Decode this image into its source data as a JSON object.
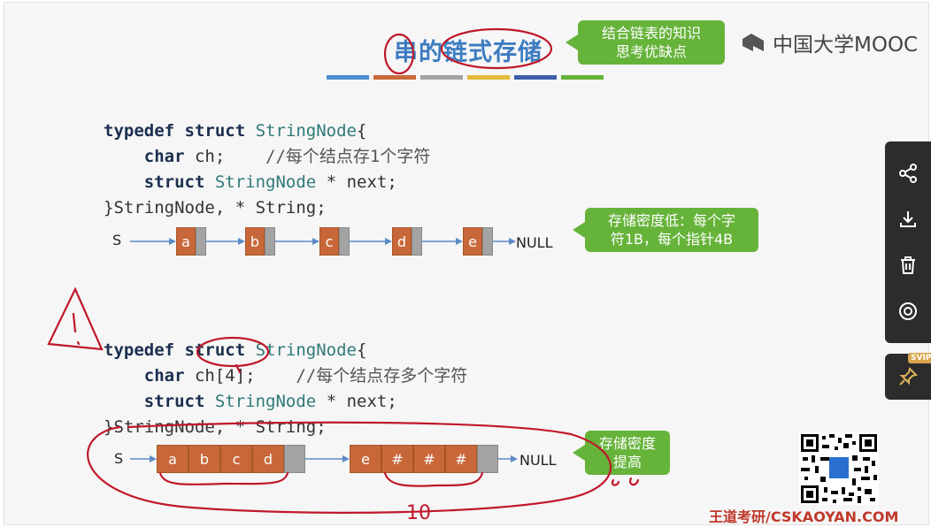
{
  "title": "串的链式存储",
  "brand": {
    "name": "中国大学MOOC"
  },
  "colors": {
    "title": "#3d7cc1",
    "callout": "#66b33a",
    "node": "#c8683a",
    "pointer": "#a3a3a3",
    "ink": "#c0182a"
  },
  "title_bar_colors": [
    "#4a8ecf",
    "#c8683a",
    "#a3a3a3",
    "#e6b93a",
    "#3d5fa8",
    "#66b33a"
  ],
  "callouts": {
    "top": "结合链表的知识\n思考优缺点",
    "middle": "存储密度低：每个字\n符1B，每个指针4B",
    "bottom": "存储密度\n提高"
  },
  "code1": {
    "l1_kw": "typedef struct",
    "l1_ty": " StringNode",
    "l1_rest": "{",
    "l2_kw": "char",
    "l2_rest": " ch;",
    "l2_cm": "    //每个结点存1个字符",
    "l3_kw": "struct",
    "l3_ty": " StringNode",
    "l3_rest": " * next;",
    "l4": "}StringNode, * String;"
  },
  "code2": {
    "l1_kw": "typedef struct",
    "l1_ty": " StringNode",
    "l1_rest": "{",
    "l2_kw": "char",
    "l2_rest": " ch[4];",
    "l2_cm": "    //每个结点存多个字符",
    "l3_kw": "struct",
    "l3_ty": " StringNode",
    "l3_rest": " * next;",
    "l4": "}StringNode, * String;"
  },
  "list1": {
    "head": "S",
    "nodes": [
      "a",
      "b",
      "c",
      "d",
      "e"
    ],
    "null": "NULL"
  },
  "list2": {
    "head": "S",
    "node1": [
      "a",
      "b",
      "c",
      "d"
    ],
    "node2": [
      "e",
      "#",
      "#",
      "#"
    ],
    "null": "NULL"
  },
  "sidebar": {
    "icons": [
      "share-icon",
      "download-icon",
      "delete-icon",
      "eye-icon"
    ],
    "pin_badge": "SVIP"
  },
  "watermark": "王道考研/CSKAOYAN.COM",
  "annotations": {
    "count_mark": "10"
  }
}
